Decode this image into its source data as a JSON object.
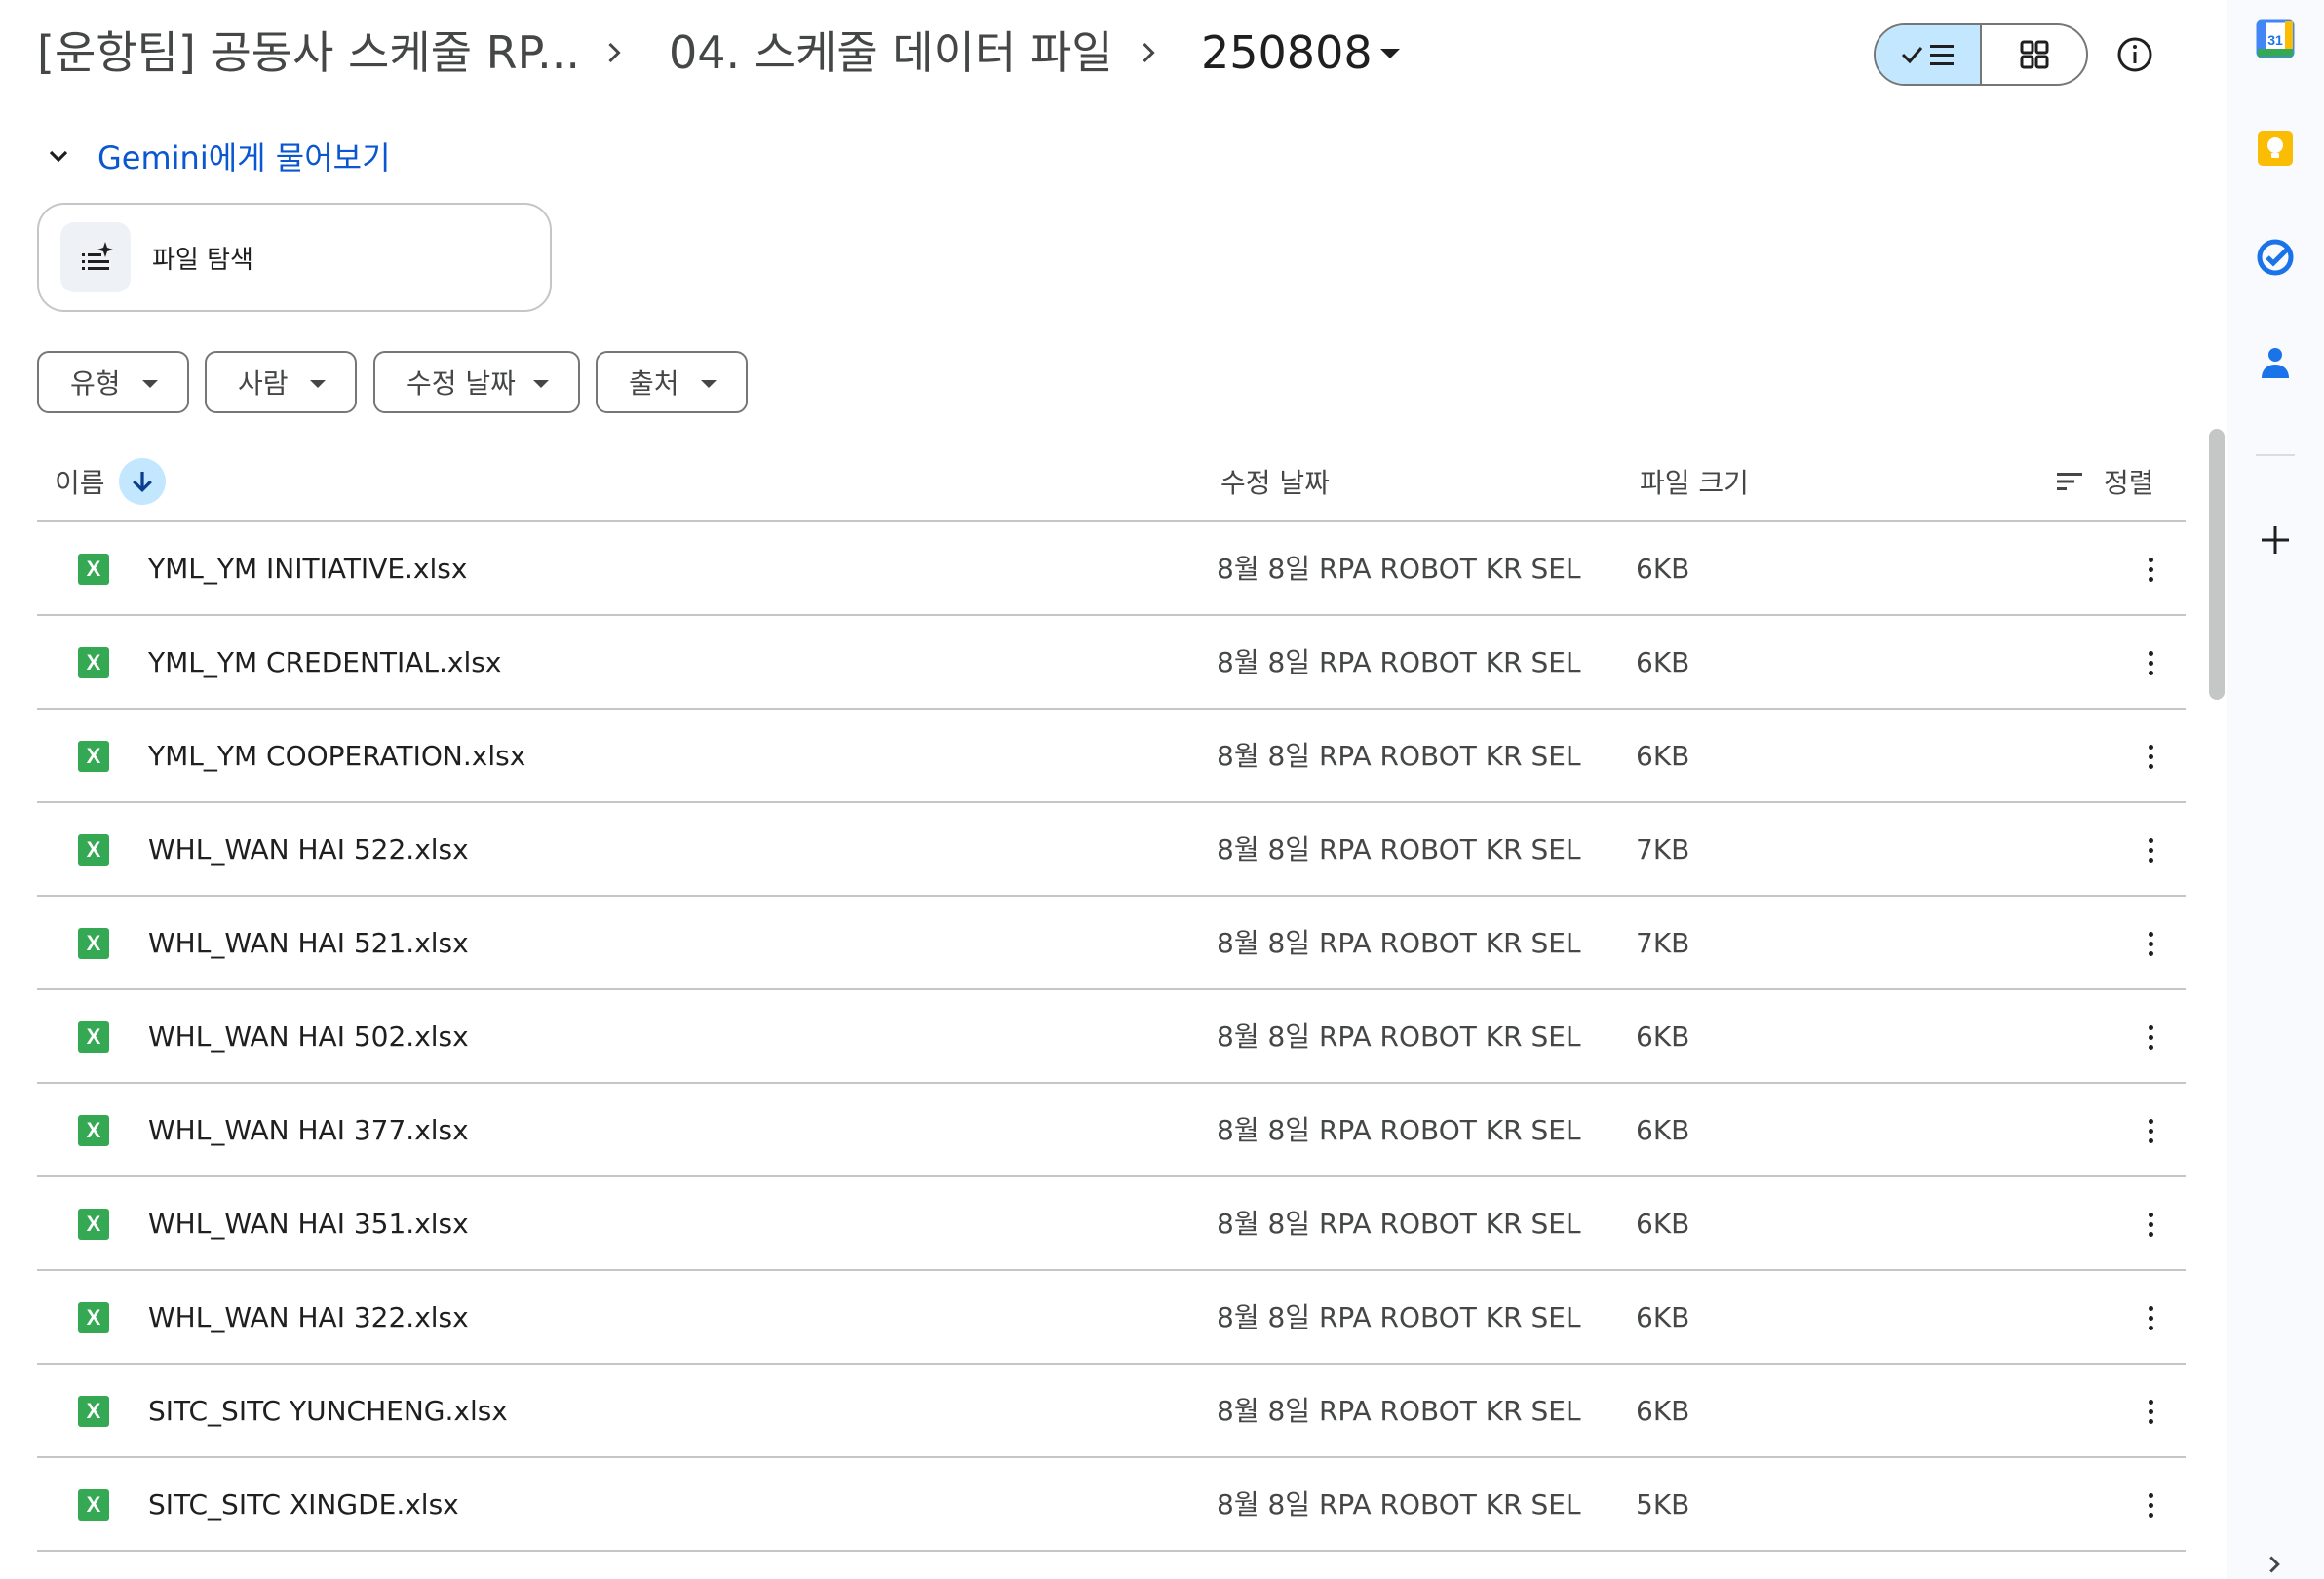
{
  "breadcrumb": {
    "root": "[운항팀] 공동사 스케줄 RP...",
    "middle": "04. 스케줄 데이터 파일",
    "current": "250808"
  },
  "gemini": {
    "brand": "Gemini",
    "rest": "에게 물어보기"
  },
  "explore": {
    "label": "파일 탐색"
  },
  "filters": [
    {
      "label": "유형"
    },
    {
      "label": "사람"
    },
    {
      "label": "수정 날짜"
    },
    {
      "label": "출처"
    }
  ],
  "table": {
    "headers": {
      "name": "이름",
      "modified": "수정 날짜",
      "size": "파일 크기",
      "sort": "정렬"
    },
    "rows": [
      {
        "name": "YML_YM INITIATIVE.xlsx",
        "modified": "8월 8일 RPA ROBOT KR SEL",
        "size": "6KB"
      },
      {
        "name": "YML_YM CREDENTIAL.xlsx",
        "modified": "8월 8일 RPA ROBOT KR SEL",
        "size": "6KB"
      },
      {
        "name": "YML_YM COOPERATION.xlsx",
        "modified": "8월 8일 RPA ROBOT KR SEL",
        "size": "6KB"
      },
      {
        "name": "WHL_WAN HAI 522.xlsx",
        "modified": "8월 8일 RPA ROBOT KR SEL",
        "size": "7KB"
      },
      {
        "name": "WHL_WAN HAI 521.xlsx",
        "modified": "8월 8일 RPA ROBOT KR SEL",
        "size": "7KB"
      },
      {
        "name": "WHL_WAN HAI 502.xlsx",
        "modified": "8월 8일 RPA ROBOT KR SEL",
        "size": "6KB"
      },
      {
        "name": "WHL_WAN HAI 377.xlsx",
        "modified": "8월 8일 RPA ROBOT KR SEL",
        "size": "6KB"
      },
      {
        "name": "WHL_WAN HAI 351.xlsx",
        "modified": "8월 8일 RPA ROBOT KR SEL",
        "size": "6KB"
      },
      {
        "name": "WHL_WAN HAI 322.xlsx",
        "modified": "8월 8일 RPA ROBOT KR SEL",
        "size": "6KB"
      },
      {
        "name": "SITC_SITC YUNCHENG.xlsx",
        "modified": "8월 8일 RPA ROBOT KR SEL",
        "size": "6KB"
      },
      {
        "name": "SITC_SITC XINGDE.xlsx",
        "modified": "8월 8일 RPA ROBOT KR SEL",
        "size": "5KB"
      }
    ],
    "file_icon_letter": "X"
  },
  "side_panel": {
    "calendar_day": "31",
    "icons": [
      "calendar-icon",
      "keep-icon",
      "tasks-icon",
      "contacts-icon",
      "add-icon"
    ]
  },
  "colors": {
    "accent": "#0b57d0",
    "selected_bg": "#c2e7ff",
    "excel_green": "#34a853",
    "keep_yellow": "#fbbc04"
  }
}
